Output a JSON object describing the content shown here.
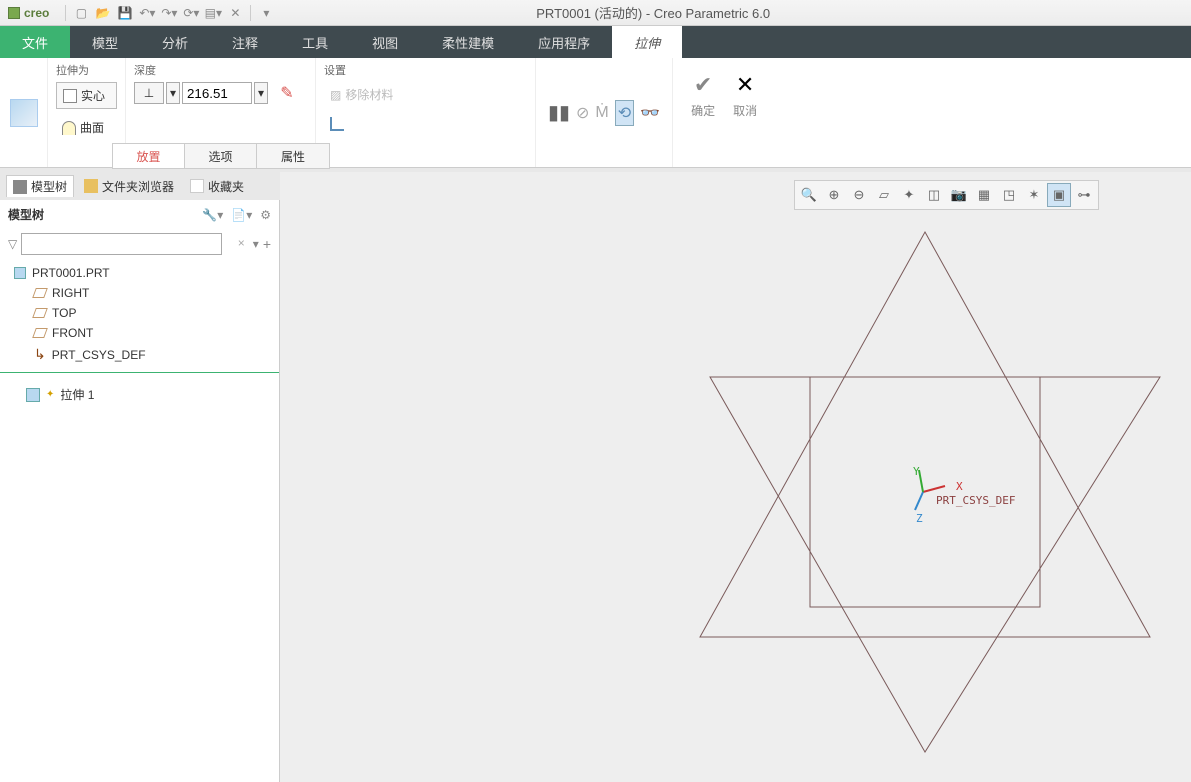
{
  "app": {
    "logo": "creo",
    "title": "PRT0001 (活动的) - Creo Parametric 6.0"
  },
  "menu": {
    "file": "文件",
    "tabs": [
      "模型",
      "分析",
      "注释",
      "工具",
      "视图",
      "柔性建模",
      "应用程序"
    ],
    "active": "拉伸"
  },
  "ribbon": {
    "extrudeAs": {
      "label": "拉伸为",
      "solid": "实心",
      "surface": "曲面"
    },
    "depth": {
      "label": "深度",
      "value": "216.51"
    },
    "settings": {
      "label": "设置",
      "remove": "移除材料"
    },
    "ok": "确定",
    "cancel": "取消",
    "subtabs": [
      "放置",
      "选项",
      "属性"
    ]
  },
  "navtabs": {
    "modelTree": "模型树",
    "folder": "文件夹浏览器",
    "fav": "收藏夹"
  },
  "tree": {
    "header": "模型树",
    "root": "PRT0001.PRT",
    "planes": [
      "RIGHT",
      "TOP",
      "FRONT"
    ],
    "csys": "PRT_CSYS_DEF",
    "feature": "拉伸 1"
  },
  "canvas": {
    "csysLabel": "PRT_CSYS_DEF",
    "axes": {
      "x": "X",
      "y": "Y",
      "z": "Z"
    }
  }
}
